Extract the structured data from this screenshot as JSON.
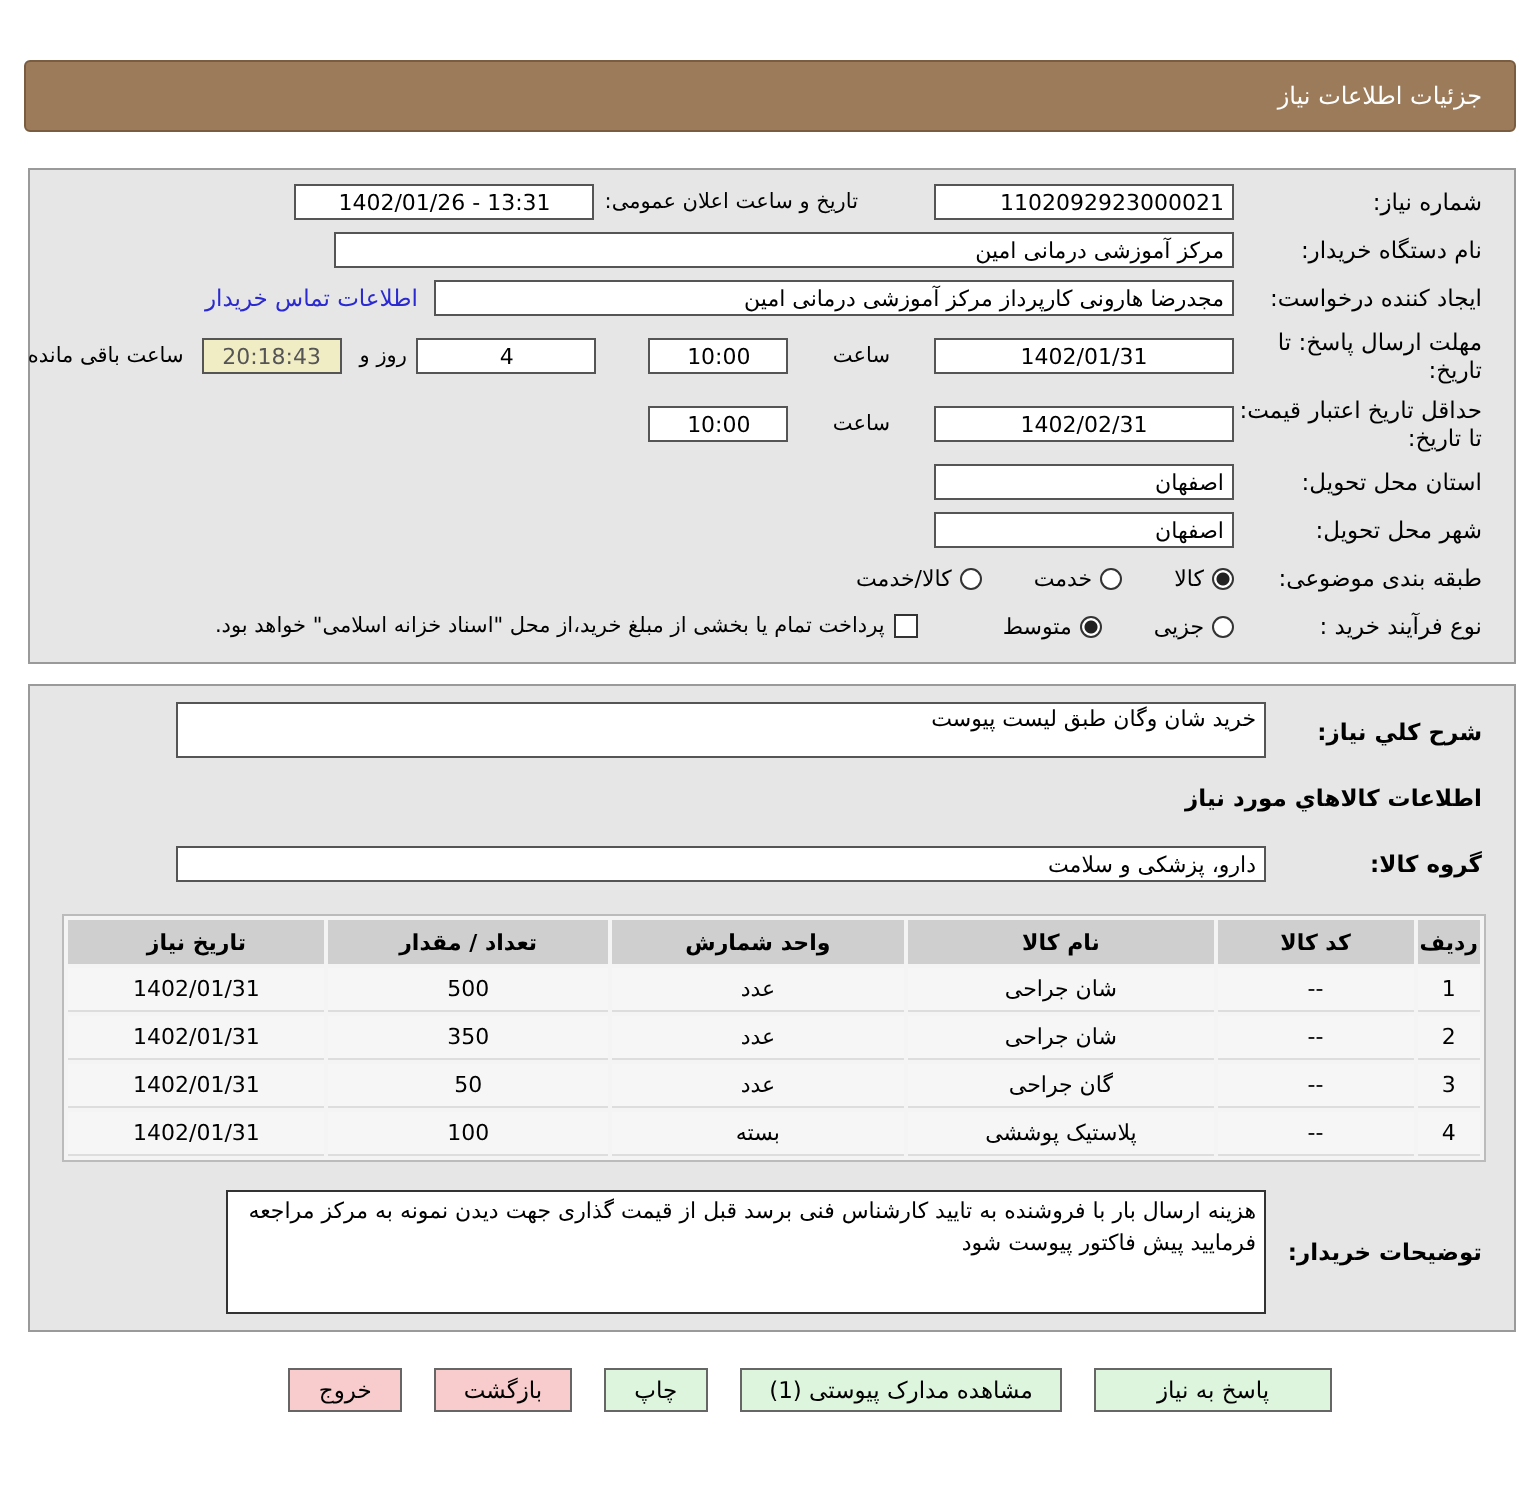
{
  "header": {
    "title": "جزئیات اطلاعات نیاز"
  },
  "details": {
    "need_number": {
      "label": "شماره نیاز:",
      "value": "1102092923000021"
    },
    "announce": {
      "label": "تاریخ و ساعت اعلان عمومی:",
      "value": "1402/01/26 - 13:31"
    },
    "buyer": {
      "label": "نام دستگاه خریدار:",
      "value": "مرکز آموزشی درمانی امین"
    },
    "creator": {
      "label": "ایجاد کننده درخواست:",
      "value": "مجدرضا هارونی کارپرداز مرکز آموزشی درمانی امین",
      "link": "اطلاعات تماس خریدار"
    },
    "deadline": {
      "label": "مهلت ارسال پاسخ: تا تاریخ:",
      "date": "1402/01/31",
      "time_label": "ساعت",
      "time": "10:00",
      "days": "4",
      "days_label": "روز و",
      "remaining": "20:18:43",
      "remaining_label": "ساعت باقی مانده"
    },
    "validity": {
      "label": "حداقل تاریخ اعتبار قیمت: تا تاریخ:",
      "date": "1402/02/31",
      "time_label": "ساعت",
      "time": "10:00"
    },
    "province": {
      "label": "استان محل تحویل:",
      "value": "اصفهان"
    },
    "city": {
      "label": "شهر محل تحویل:",
      "value": "اصفهان"
    },
    "category": {
      "label": "طبقه بندی موضوعی:",
      "options": [
        {
          "label": "کالا",
          "selected": true
        },
        {
          "label": "خدمت",
          "selected": false
        },
        {
          "label": "کالا/خدمت",
          "selected": false
        }
      ]
    },
    "process": {
      "label": "نوع فرآیند خرید :",
      "options": [
        {
          "label": "جزیی",
          "selected": false
        },
        {
          "label": "متوسط",
          "selected": true
        }
      ],
      "treasury": {
        "label": "پرداخت تمام یا بخشی از مبلغ خرید،از محل \"اسناد خزانه اسلامی\" خواهد بود.",
        "checked": false
      }
    }
  },
  "summary": {
    "label": "شرح کلي نياز:",
    "value": "خرید شان وگان طبق لیست پیوست"
  },
  "goods_title": "اطلاعات کالاهاي مورد نياز",
  "group": {
    "label": "گروه کالا:",
    "value": "دارو، پزشکی و سلامت"
  },
  "table": {
    "columns": [
      "ردیف",
      "کد کالا",
      "نام کالا",
      "واحد شمارش",
      "تعداد / مقدار",
      "تاریخ نیاز"
    ],
    "rows": [
      [
        "1",
        "--",
        "شان جراحی",
        "عدد",
        "500",
        "1402/01/31"
      ],
      [
        "2",
        "--",
        "شان جراحی",
        "عدد",
        "350",
        "1402/01/31"
      ],
      [
        "3",
        "--",
        "گان جراحی",
        "عدد",
        "50",
        "1402/01/31"
      ],
      [
        "4",
        "--",
        "پلاستیک پوششی",
        "بسته",
        "100",
        "1402/01/31"
      ]
    ]
  },
  "notes": {
    "label": "توضیحات خریدار:",
    "value": "هزینه ارسال بار با فروشنده به تایید کارشناس فنی برسد قبل از قیمت گذاری جهت دیدن نمونه به مرکز مراجعه فرمایید پیش فاکتور پیوست شود"
  },
  "buttons": [
    {
      "label": "پاسخ به نیاز",
      "kind": "action"
    },
    {
      "label": "مشاهده مدارک پیوستی (1)",
      "kind": "action"
    },
    {
      "label": "چاپ",
      "kind": "action"
    },
    {
      "label": "بازگشت",
      "kind": "danger"
    },
    {
      "label": "خروج",
      "kind": "danger"
    }
  ]
}
